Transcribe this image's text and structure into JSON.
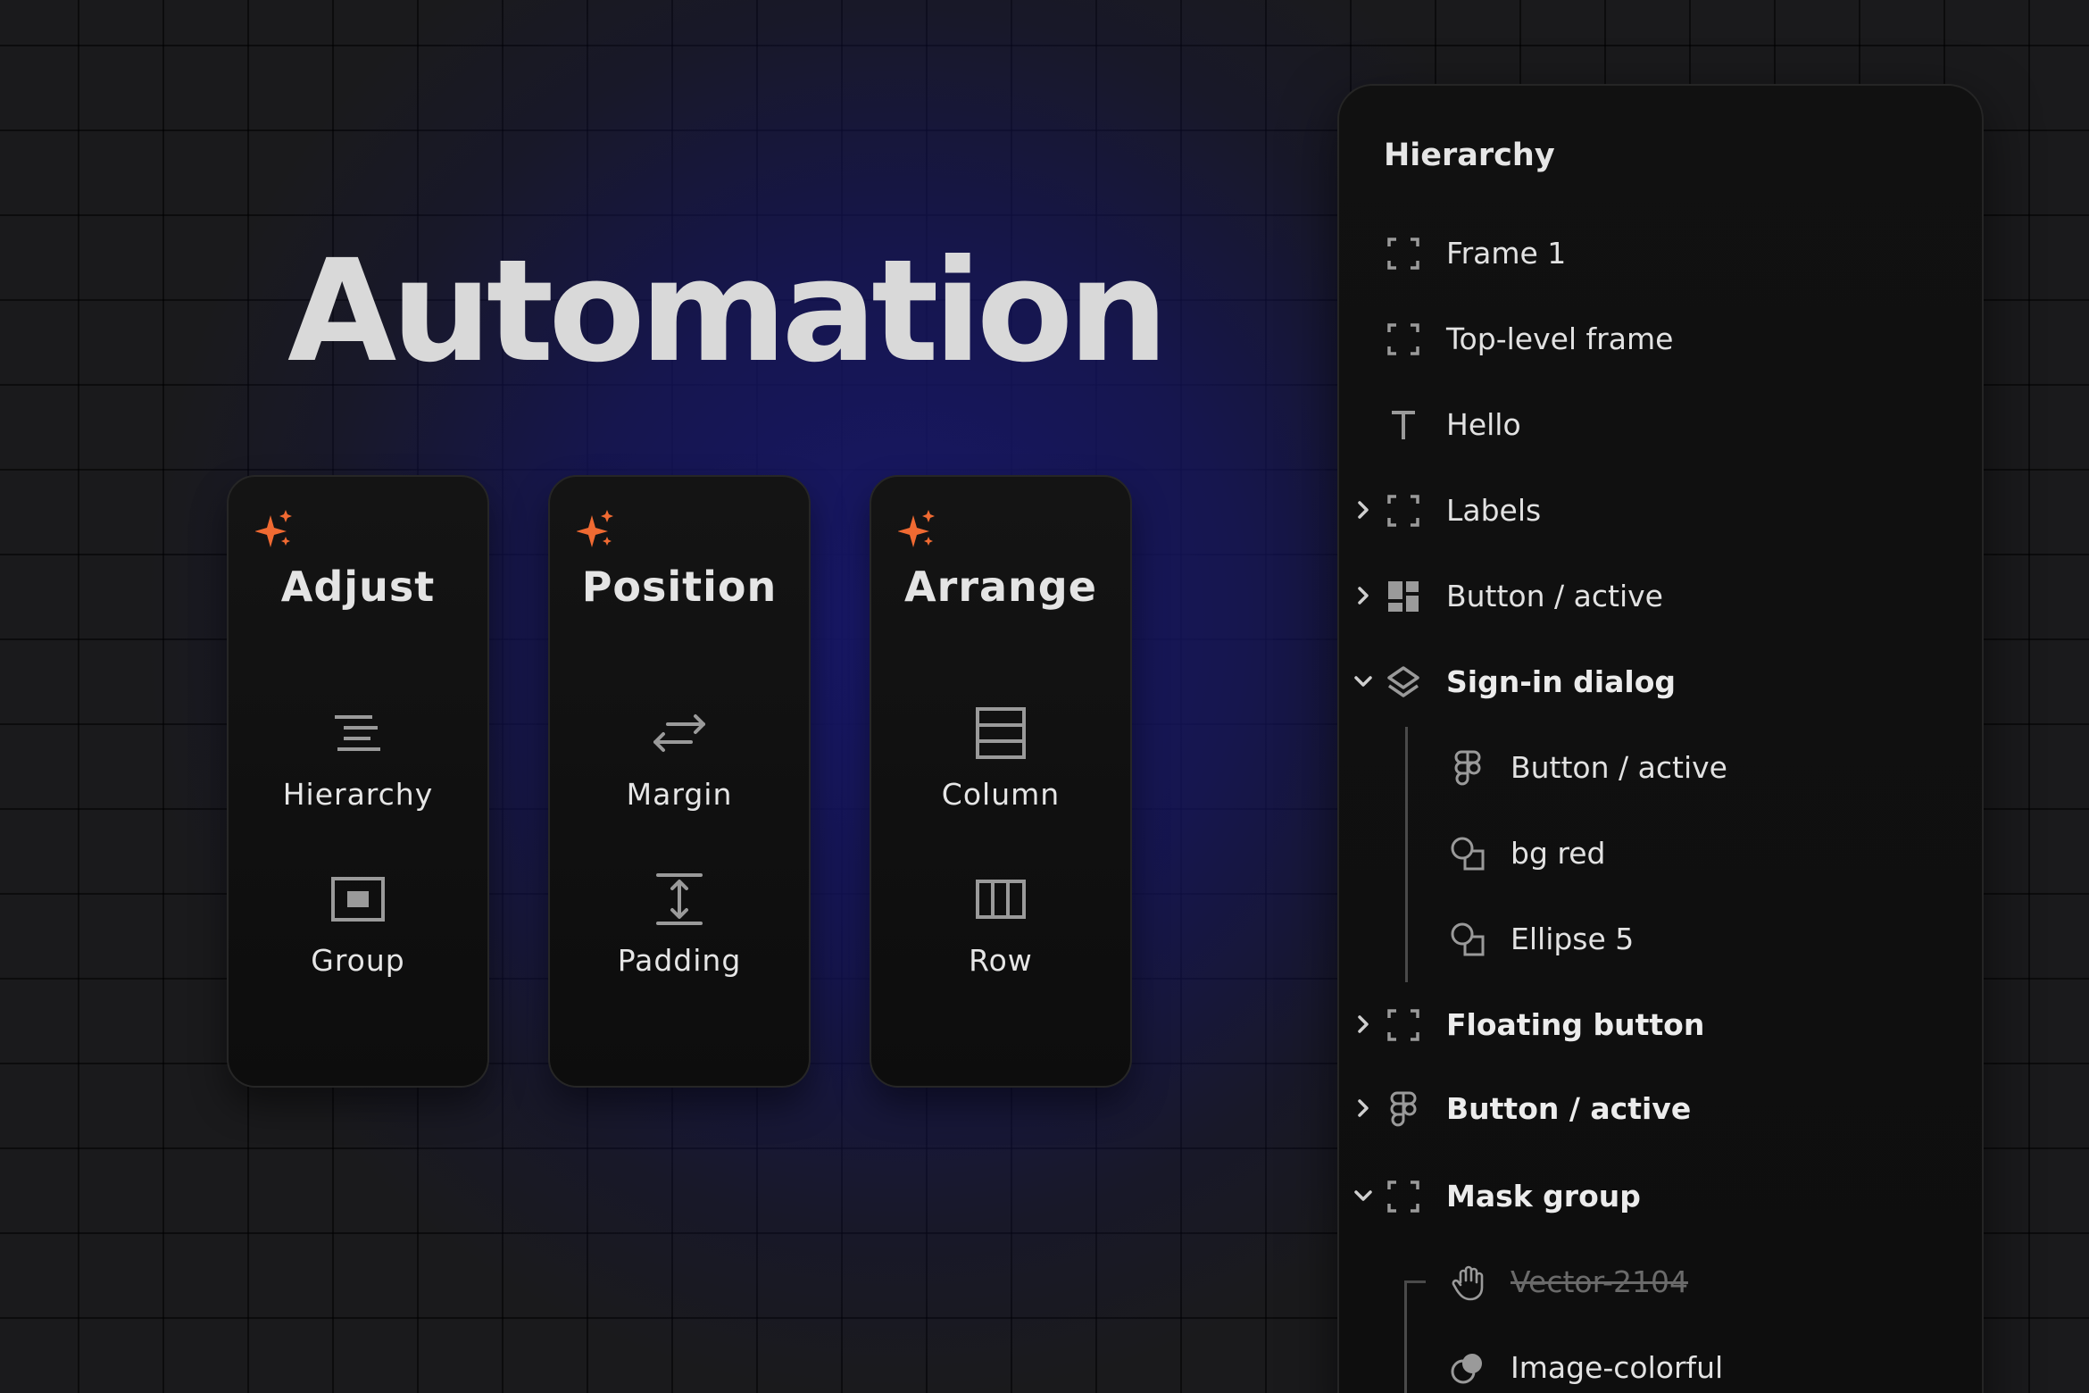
{
  "hero": {
    "title": "Automation"
  },
  "colors": {
    "accent": "#f06a32",
    "background": "#1a1a1c",
    "glow": "#18186e",
    "text": "#e6e6e6",
    "muted": "#6a6a6a",
    "icon": "#9a9a9a"
  },
  "cards": [
    {
      "title": "Adjust",
      "icon": "sparkle-icon",
      "items": [
        {
          "label": "Hierarchy",
          "icon": "hierarchy-icon"
        },
        {
          "label": "Group",
          "icon": "group-icon"
        }
      ]
    },
    {
      "title": "Position",
      "icon": "sparkle-icon",
      "items": [
        {
          "label": "Margin",
          "icon": "margin-icon"
        },
        {
          "label": "Padding",
          "icon": "padding-icon"
        }
      ]
    },
    {
      "title": "Arrange",
      "icon": "sparkle-icon",
      "items": [
        {
          "label": "Column",
          "icon": "column-icon"
        },
        {
          "label": "Row",
          "icon": "row-icon"
        }
      ]
    }
  ],
  "panel": {
    "title": "Hierarchy",
    "layers": [
      {
        "label": "Frame 1",
        "icon": "frame-icon"
      },
      {
        "label": "Top-level frame",
        "icon": "frame-icon"
      },
      {
        "label": "Hello",
        "icon": "text-icon"
      },
      {
        "label": "Labels",
        "icon": "frame-icon",
        "chevron": "collapsed"
      },
      {
        "label": "Button / active",
        "icon": "component-icon",
        "chevron": "collapsed"
      },
      {
        "label": "Sign-in dialog",
        "icon": "layers-icon",
        "chevron": "expanded",
        "bold": true
      },
      {
        "label": "Button / active",
        "icon": "figma-icon"
      },
      {
        "label": "bg red",
        "icon": "shapes-icon"
      },
      {
        "label": "Ellipse 5",
        "icon": "shapes-icon"
      },
      {
        "label": "Floating button",
        "icon": "frame-icon",
        "chevron": "collapsed",
        "bold": true
      },
      {
        "label": "Button / active",
        "icon": "figma-icon",
        "chevron": "collapsed",
        "bold": true
      },
      {
        "label": "Mask group",
        "icon": "frame-icon",
        "chevron": "expanded",
        "bold": true
      },
      {
        "label": "Vector-2104",
        "icon": "hand-icon",
        "struck": true
      },
      {
        "label": "Image-colorful",
        "icon": "image-icon"
      }
    ]
  }
}
